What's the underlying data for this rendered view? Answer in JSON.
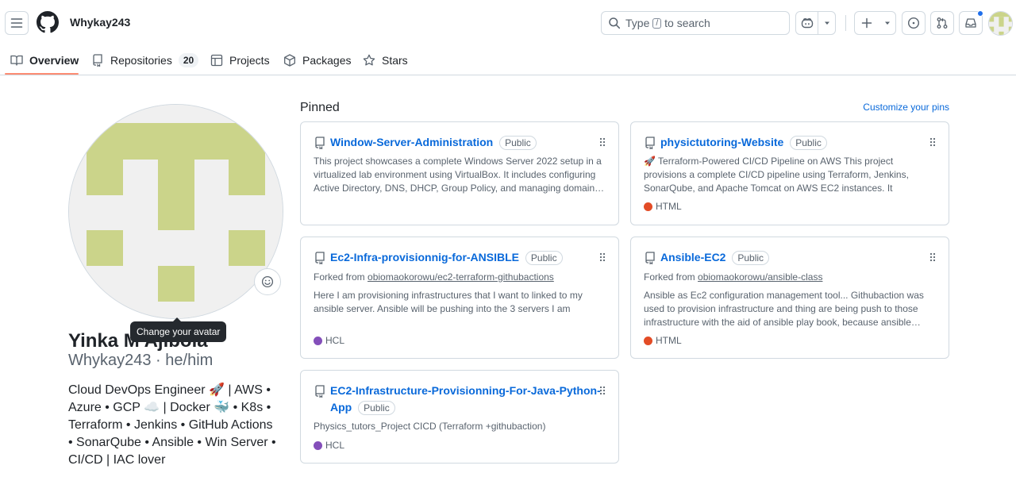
{
  "header": {
    "username": "Whykay243",
    "search": {
      "prefix": "Type",
      "key": "/",
      "suffix": "to search"
    }
  },
  "tabs": [
    {
      "label": "Overview",
      "icon": "book-icon"
    },
    {
      "label": "Repositories",
      "icon": "repo-icon",
      "count": "20"
    },
    {
      "label": "Projects",
      "icon": "table-icon"
    },
    {
      "label": "Packages",
      "icon": "package-icon"
    },
    {
      "label": "Stars",
      "icon": "star-icon"
    }
  ],
  "profile": {
    "tooltip": "Change your avatar",
    "full_name": "Yinka M Ajibola",
    "handle": "Whykay243 · he/him",
    "bio": "Cloud DevOps Engineer 🚀 | AWS • Azure • GCP ☁️ | Docker 🐳 • K8s • Terraform • Jenkins • GitHub Actions • SonarQube • Ansible • Win Server • CI/CD | IAC lover",
    "identicon_color": "#cbd48a"
  },
  "pinned": {
    "title": "Pinned",
    "customize": "Customize your pins",
    "repos": [
      {
        "name": "Window-Server-Administration",
        "visibility": "Public",
        "description": "This project showcases a complete Windows Server 2022 setup in a virtualized lab environment using VirtualBox. It includes configuring Active Directory, DNS, DHCP, Group Policy, and managing domain…"
      },
      {
        "name": "physictutoring-Website",
        "visibility": "Public",
        "description": "🚀 Terraform-Powered CI/CD Pipeline on AWS This project provisions a complete CI/CD pipeline using Terraform, Jenkins, SonarQube, and Apache Tomcat on AWS EC2 instances. It automates the process of …",
        "language": "HTML",
        "language_color": "#e34c26"
      },
      {
        "name": "Ec2-Infra-provisionnig-for-ANSIBLE",
        "visibility": "Public",
        "forked_prefix": "Forked from",
        "forked_from": "obiomaokorowu/ec2-terraform-githubactions",
        "description": "Here I am provisioning infrastructures that I want to linked to my ansible server. Ansible will be pushing into the 3 servers I am provisioning here",
        "language": "HCL",
        "language_color": "#844fba"
      },
      {
        "name": "Ansible-EC2",
        "visibility": "Public",
        "forked_prefix": "Forked from",
        "forked_from": "obiomaokorowu/ansible-class",
        "description": "Ansible as Ec2 configuration management tool... Githubaction was used to provision infrastructure and thing are being push to those infrastructure with the aid of ansible play book, because ansible…",
        "language": "HTML",
        "language_color": "#e34c26"
      },
      {
        "name": "EC2-Infrastructure-Provisionning-For-Java-Python-App",
        "visibility": "Public",
        "description": "Physics_tutors_Project CICD (Terraform +githubaction)",
        "language": "HCL",
        "language_color": "#844fba"
      }
    ]
  }
}
